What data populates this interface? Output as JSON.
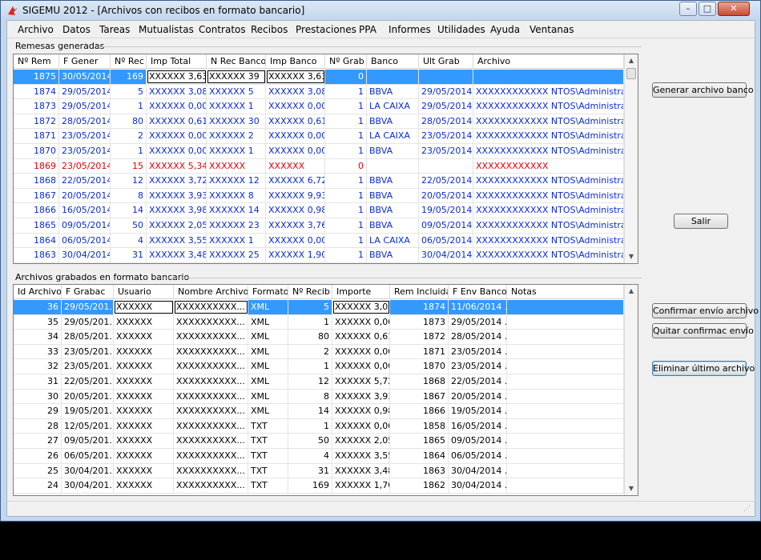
{
  "window": {
    "title": "SIGEMU 2012 - [Archivos con recibos en formato bancario]"
  },
  "menu": [
    "Archivo",
    "Datos",
    "Tareas",
    "Mutualistas",
    "Contratos",
    "Recibos",
    "Prestaciones",
    "PPA",
    "Informes",
    "Utilidades",
    "Ayuda",
    "Ventanas"
  ],
  "remesas": {
    "label": "Remesas generadas",
    "columns": [
      "Nº Rem",
      "F Gener",
      "Nº Rec",
      "Imp Total",
      "N Rec Banco",
      "Imp Banco",
      "Nº Grab",
      "Banco",
      "Ult Grab",
      "Archivo"
    ],
    "rows": [
      [
        "1875",
        "30/05/2014",
        "169",
        "XXXXXX 3,63",
        "XXXXXX 39",
        "XXXXXX 3,63",
        "0",
        "",
        "",
        ""
      ],
      [
        "1874",
        "29/05/2014",
        "5",
        "XXXXXX 3,08",
        "XXXXXX  5",
        "XXXXXX 3,08",
        "1",
        "BBVA",
        "29/05/2014",
        "XXXXXXXXXXXX NTOS\\Administra..."
      ],
      [
        "1873",
        "29/05/2014",
        "1",
        "XXXXXX 0,00",
        "XXXXXX  1",
        "XXXXXX 0,00",
        "1",
        "LA CAIXA",
        "29/05/2014",
        "XXXXXXXXXXXX NTOS\\Administra..."
      ],
      [
        "1872",
        "28/05/2014",
        "80",
        "XXXXXX 0,61",
        "XXXXXX 30",
        "XXXXXX 0,61",
        "1",
        "BBVA",
        "28/05/2014",
        "XXXXXXXXXXXX NTOS\\Administra..."
      ],
      [
        "1871",
        "23/05/2014",
        "2",
        "XXXXXX 0,00",
        "XXXXXX  2",
        "XXXXXX 0,00",
        "1",
        "LA CAIXA",
        "23/05/2014",
        "XXXXXXXXXXXX NTOS\\Administra..."
      ],
      [
        "1870",
        "23/05/2014",
        "1",
        "XXXXXX 0,00",
        "XXXXXX  1",
        "XXXXXX 0,00",
        "1",
        "BBVA",
        "23/05/2014",
        "XXXXXXXXXXXX NTOS\\Administra..."
      ],
      [
        "1869",
        "23/05/2014",
        "15",
        "XXXXXX 5,34",
        "XXXXXX",
        "XXXXXX",
        "0",
        "",
        "",
        "XXXXXXXXXXXX"
      ],
      [
        "1868",
        "22/05/2014",
        "12",
        "XXXXXX 3,72",
        "XXXXXX 12",
        "XXXXXX 6,72",
        "1",
        "BBVA",
        "22/05/2014",
        "XXXXXXXXXXXX NTOS\\Administra..."
      ],
      [
        "1867",
        "20/05/2014",
        "8",
        "XXXXXX 3,93",
        "XXXXXX  8",
        "XXXXXX 9,93",
        "1",
        "BBVA",
        "20/05/2014",
        "XXXXXXXXXXXX NTOS\\Administra..."
      ],
      [
        "1866",
        "16/05/2014",
        "14",
        "XXXXXX 3,98",
        "XXXXXX 14",
        "XXXXXX 0,98",
        "1",
        "BBVA",
        "19/05/2014",
        "XXXXXXXXXXXX NTOS\\Administra..."
      ],
      [
        "1865",
        "09/05/2014",
        "50",
        "XXXXXX 2,05",
        "XXXXXX 23",
        "XXXXXX 3,76",
        "1",
        "BBVA",
        "09/05/2014",
        "XXXXXXXXXXXX NTOS\\Administra..."
      ],
      [
        "1864",
        "06/05/2014",
        "4",
        "XXXXXX 3,55",
        "XXXXXX  1",
        "XXXXXX 0,00",
        "1",
        "LA CAIXA",
        "06/05/2014",
        "XXXXXXXXXXXX NTOS\\Administra..."
      ],
      [
        "1863",
        "30/04/2014",
        "31",
        "XXXXXX 3,48",
        "XXXXXX 25",
        "XXXXXX 1,90",
        "1",
        "BBVA",
        "30/04/2014",
        "XXXXXXXXXXXX NTOS\\Administra..."
      ]
    ]
  },
  "archivos": {
    "label": "Archivos grabados en formato bancario",
    "columns": [
      "Id Archivo",
      "F Grabac",
      "Usuario",
      "Nombre Archivo",
      "Formato",
      "Nº Recib",
      "Importe",
      "Rem Incluida",
      "F Env Banco",
      "Notas"
    ],
    "rows": [
      [
        "36",
        "29/05/201...",
        "XXXXXX",
        "XXXXXXXXXX...",
        "XML",
        "5",
        "XXXXXX 3,08",
        "1874",
        "11/06/2014 ...",
        ""
      ],
      [
        "35",
        "29/05/201...",
        "XXXXXX",
        "XXXXXXXXXX...",
        "XML",
        "1",
        "XXXXXX 0,00",
        "1873",
        "29/05/2014 ...",
        ""
      ],
      [
        "34",
        "28/05/201...",
        "XXXXXX",
        "XXXXXXXXXX...",
        "XML",
        "80",
        "XXXXXX 0,61",
        "1872",
        "28/05/2014 ...",
        ""
      ],
      [
        "33",
        "23/05/201...",
        "XXXXXX",
        "XXXXXXXXXX...",
        "XML",
        "2",
        "XXXXXX 0,00",
        "1871",
        "23/05/2014 ...",
        ""
      ],
      [
        "32",
        "23/05/201...",
        "XXXXXX",
        "XXXXXXXXXX...",
        "XML",
        "1",
        "XXXXXX 0,00",
        "1870",
        "23/05/2014 ...",
        ""
      ],
      [
        "31",
        "22/05/201...",
        "XXXXXX",
        "XXXXXXXXXX...",
        "XML",
        "12",
        "XXXXXX 5,72",
        "1868",
        "22/05/2014 ...",
        ""
      ],
      [
        "30",
        "20/05/201...",
        "XXXXXX",
        "XXXXXXXXXX...",
        "XML",
        "8",
        "XXXXXX 3,93",
        "1867",
        "20/05/2014 ...",
        ""
      ],
      [
        "29",
        "19/05/201...",
        "XXXXXX",
        "XXXXXXXXXX...",
        "XML",
        "14",
        "XXXXXX 0,98",
        "1866",
        "19/05/2014 ...",
        ""
      ],
      [
        "28",
        "12/05/201...",
        "XXXXXX",
        "XXXXXXXXXX...",
        "TXT",
        "1",
        "XXXXXX 0,00",
        "1858",
        "16/05/2014 ...",
        ""
      ],
      [
        "27",
        "09/05/201...",
        "XXXXXX",
        "XXXXXXXXXX...",
        "TXT",
        "50",
        "XXXXXX 2,05",
        "1865",
        "09/05/2014 ...",
        ""
      ],
      [
        "26",
        "06/05/201...",
        "XXXXXX",
        "XXXXXXXXXX...",
        "TXT",
        "4",
        "XXXXXX 3,55",
        "1864",
        "06/05/2014 ...",
        ""
      ],
      [
        "25",
        "30/04/201...",
        "XXXXXX",
        "XXXXXXXXXX...",
        "TXT",
        "31",
        "XXXXXX 3,48",
        "1863",
        "30/04/2014 ...",
        ""
      ],
      [
        "24",
        "30/04/201...",
        "XXXXXX",
        "XXXXXXXXXX...",
        "TXT",
        "169",
        "XXXXXX 1,70",
        "1862",
        "30/04/2014 ...",
        ""
      ]
    ]
  },
  "buttons": {
    "generar": "Generar archivo banco",
    "salir": "Salir",
    "confirmar": "Confirmar envío archivo",
    "quitar": "Quitar confirmac envío",
    "eliminar": "Eliminar último archivo"
  },
  "colors": {
    "selection": "#3399ff",
    "blue_text": "#0b2bd6",
    "red_text": "#e00000"
  },
  "icons": {
    "app": "sigemu-app-icon",
    "minimize": "minimize-icon",
    "maximize": "maximize-icon",
    "close": "close-icon"
  }
}
